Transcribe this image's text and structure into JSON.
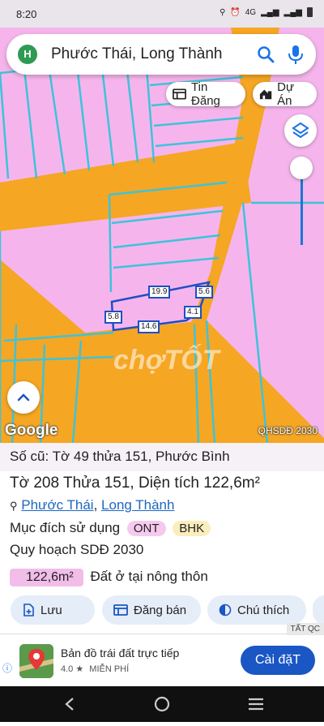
{
  "status_bar": {
    "time": "8:20",
    "network": "4G"
  },
  "search": {
    "avatar_letter": "H",
    "query": "Phước Thái, Long Thành"
  },
  "map_chips": {
    "listing_label": "Tin Đăng",
    "project_label": "Dự Án"
  },
  "map": {
    "google_label": "Google",
    "layer_label": "QHSDĐ 2030",
    "watermark": "chợTỐT",
    "dimensions": [
      "19.9",
      "5.6",
      "5.8",
      "4.1",
      "14.6"
    ]
  },
  "info": {
    "old_record": "Số cũ: Tờ 49 thửa 151, Phước Bình",
    "parcel": "Tờ 208 Thửa 151, Diện tích 122,6m²",
    "location_ward": "Phước Thái",
    "location_sep": ", ",
    "location_district": "Long Thành",
    "usage_label": "Mục đích sử dụng",
    "usage_tags": [
      "ONT",
      "BHK"
    ],
    "planning_label": "Quy hoạch SDĐ 2030",
    "planning_area": "122,6m²",
    "planning_desc": "Đất ở tại nông thôn"
  },
  "actions": {
    "save": "Lưu",
    "post": "Đăng bán",
    "legend": "Chú thích"
  },
  "ad": {
    "tag": "TẤT QC",
    "title": "Bản đồ trái đất trực tiếp",
    "rating": "4.0 ★",
    "price": "MIỄN PHÍ",
    "install": "Cài đặT"
  },
  "colors": {
    "land_pink": "#f5b5ec",
    "road_orange": "#f5a623",
    "parcel_blue": "#3ec3d9",
    "accent_blue": "#1a56c4"
  }
}
